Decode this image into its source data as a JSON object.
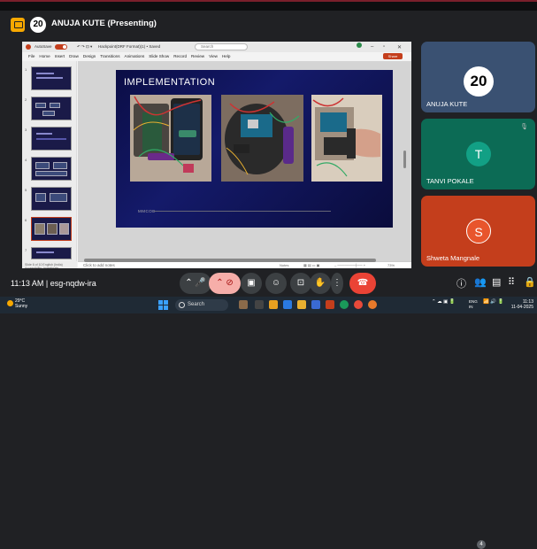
{
  "presenter": {
    "avatar_text": "20",
    "title": "ANUJA KUTE (Presenting)"
  },
  "ppt": {
    "autosave_label": "AutoSave",
    "file_name": "Hackpoint(DRF Format)(1) • Saved",
    "search_placeholder": "Search",
    "share_label": "Share",
    "menu": [
      "File",
      "Home",
      "Insert",
      "Draw",
      "Design",
      "Transitions",
      "Animations",
      "Slide Show",
      "Record",
      "Review",
      "View",
      "Help"
    ],
    "slide_numbers": [
      "1",
      "2",
      "3",
      "4",
      "5",
      "6",
      "7",
      "8"
    ],
    "slide": {
      "title": "IMPLEMENTATION",
      "footer": "MMCOE"
    },
    "notes_placeholder": "Click to add notes",
    "status_text": "Slide 6 of 10   English (India)   Accessibility: Investigate",
    "notes_btn": "Notes",
    "zoom": "73%"
  },
  "participants": [
    {
      "avatar": "20",
      "name": "ANUJA KUTE"
    },
    {
      "avatar": "T",
      "name": "TANVI POKALE"
    },
    {
      "avatar": "S",
      "name": "Shweta Mangnale"
    }
  ],
  "callbar": {
    "time_meeting": "11:13 AM  |  esg-nqdw-ira",
    "participant_badge": "4"
  },
  "taskbar": {
    "weather_temp": "29°C",
    "weather_desc": "Sunny",
    "search_placeholder": "Search",
    "lang_top": "ENG",
    "lang_bottom": "IN",
    "time": "11:13",
    "date": "11-04-2025"
  },
  "colors": {
    "accent_ppt": "#c43e1c",
    "tile_teal": "#0c6b55",
    "tile_orange": "#c43e1c",
    "end_call": "#ea4335"
  }
}
